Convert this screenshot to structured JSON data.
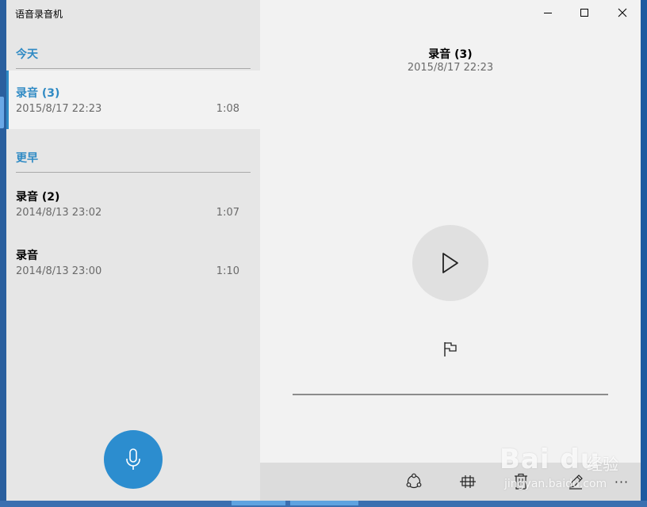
{
  "app": {
    "title": "语音录音机"
  },
  "window_controls": {
    "minimize": "minimize-icon",
    "maximize": "maximize-icon",
    "close": "close-icon"
  },
  "groups": [
    {
      "header": "今天",
      "items": [
        {
          "name": "录音 (3)",
          "date": "2015/8/17 22:23",
          "duration": "1:08",
          "selected": true
        }
      ]
    },
    {
      "header": "更早",
      "items": [
        {
          "name": "录音 (2)",
          "date": "2014/8/13 23:02",
          "duration": "1:07",
          "selected": false
        },
        {
          "name": "录音",
          "date": "2014/8/13 23:00",
          "duration": "1:10",
          "selected": false
        }
      ]
    }
  ],
  "detail": {
    "title": "录音 (3)",
    "date": "2015/8/17 22:23"
  },
  "playback": {
    "position": 0
  },
  "commands": [
    "share-icon",
    "trim-icon",
    "delete-icon",
    "rename-icon",
    "more-icon"
  ],
  "colors": {
    "accent": "#2f8ac4",
    "mic_button": "#2c8dcf"
  },
  "watermark": {
    "logo": "Bai du",
    "cn": "经验",
    "url": "jingyan.baidu.com"
  }
}
